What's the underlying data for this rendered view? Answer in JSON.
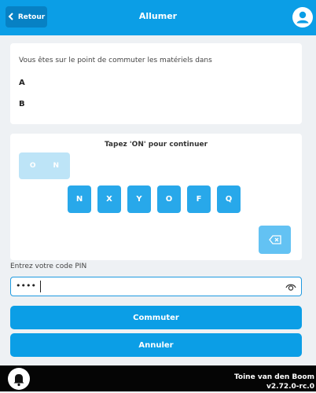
{
  "header": {
    "back_label": "Retour",
    "title": "Allumer",
    "back_icon": "chevron-left-icon",
    "avatar_icon": "user-icon",
    "color": "#0b9ee6"
  },
  "summary": {
    "intro": "Vous êtes sur le point de commuter les matériels dans",
    "items": [
      "A",
      "B"
    ]
  },
  "confirm": {
    "prompt": "Tapez 'ON' pour continuer",
    "typed": [
      "O",
      "N"
    ],
    "keys": [
      "N",
      "X",
      "Y",
      "O",
      "F",
      "Q"
    ],
    "backspace_icon": "backspace-icon",
    "key_color": "#28a8ea"
  },
  "pin": {
    "label": "Entrez votre code PIN",
    "value": "••••",
    "eye_icon": "eye-icon"
  },
  "actions": {
    "commute_label": "Commuter",
    "cancel_label": "Annuler"
  },
  "footer": {
    "bell_icon": "bell-icon",
    "user_name": "Toine van den Boom",
    "version": "v2.72.0-rc.0"
  }
}
